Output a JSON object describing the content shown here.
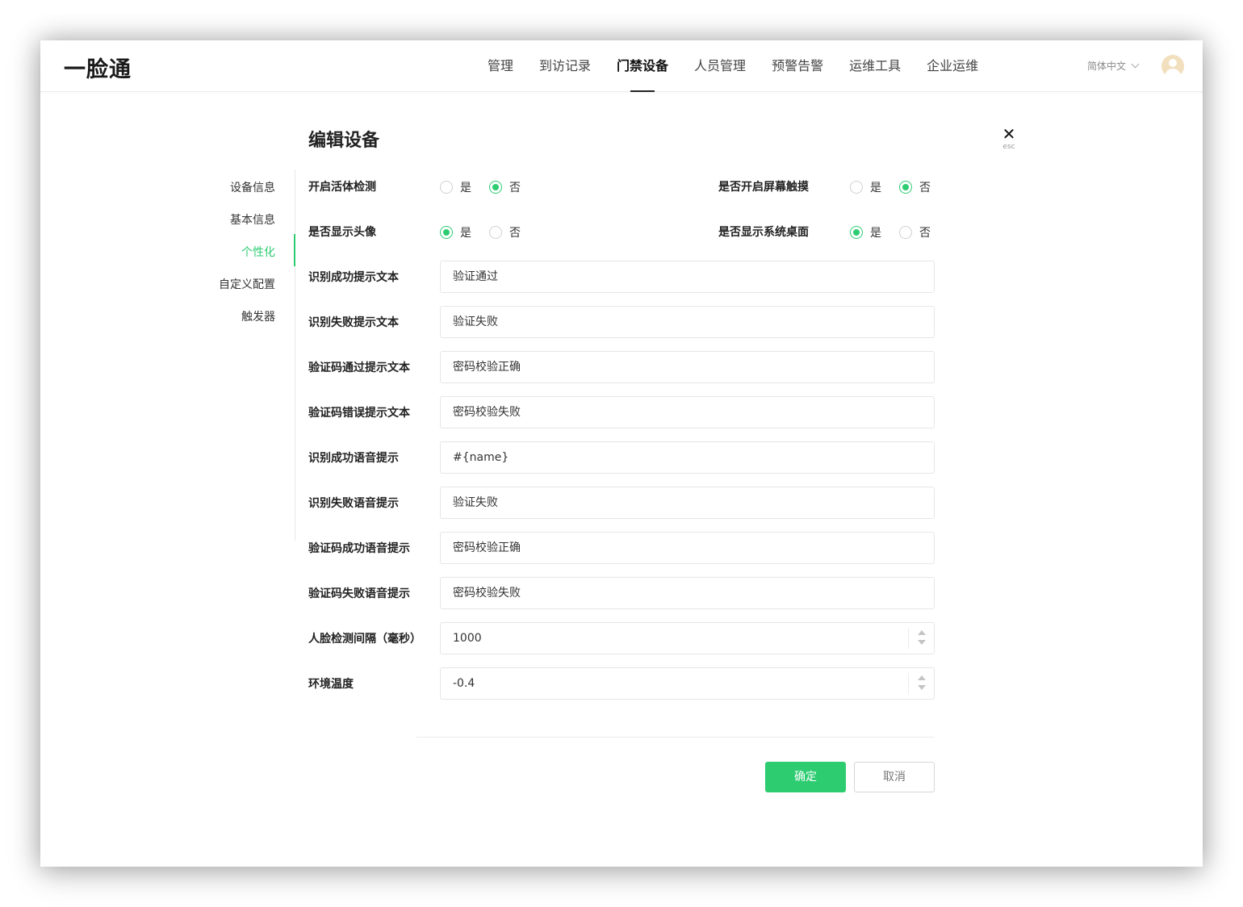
{
  "app": {
    "logo": "一脸通"
  },
  "nav": {
    "items": [
      "管理",
      "到访记录",
      "门禁设备",
      "人员管理",
      "预警告警",
      "运维工具",
      "企业运维"
    ],
    "active_index": 2,
    "language": "简体中文"
  },
  "page": {
    "title": "编辑设备",
    "close_label": "esc"
  },
  "side_menu": {
    "items": [
      "设备信息",
      "基本信息",
      "个性化",
      "自定义配置",
      "触发器"
    ],
    "active_index": 2
  },
  "radio_options": {
    "yes": "是",
    "no": "否"
  },
  "toggles": [
    {
      "label": "开启活体检测",
      "value": "否"
    },
    {
      "label": "是否开启屏幕触摸",
      "value": "否"
    },
    {
      "label": "是否显示头像",
      "value": "是"
    },
    {
      "label": "是否显示系统桌面",
      "value": "是"
    }
  ],
  "fields": [
    {
      "label": "识别成功提示文本",
      "value": "验证通过"
    },
    {
      "label": "识别失败提示文本",
      "value": "验证失败"
    },
    {
      "label": "验证码通过提示文本",
      "value": "密码校验正确"
    },
    {
      "label": "验证码错误提示文本",
      "value": "密码校验失败"
    },
    {
      "label": "识别成功语音提示",
      "value": "#{name}"
    },
    {
      "label": "识别失败语音提示",
      "value": "验证失败"
    },
    {
      "label": "验证码成功语音提示",
      "value": "密码校验正确"
    },
    {
      "label": "验证码失败语音提示",
      "value": "密码校验失败"
    },
    {
      "label": "人脸检测间隔（毫秒）",
      "value": "1000"
    },
    {
      "label": "环境温度",
      "value": "-0.4"
    }
  ],
  "buttons": {
    "confirm": "确定",
    "cancel": "取消"
  },
  "colors": {
    "accent": "#2ecc71",
    "text": "#222222",
    "border": "#e6e6e6"
  }
}
